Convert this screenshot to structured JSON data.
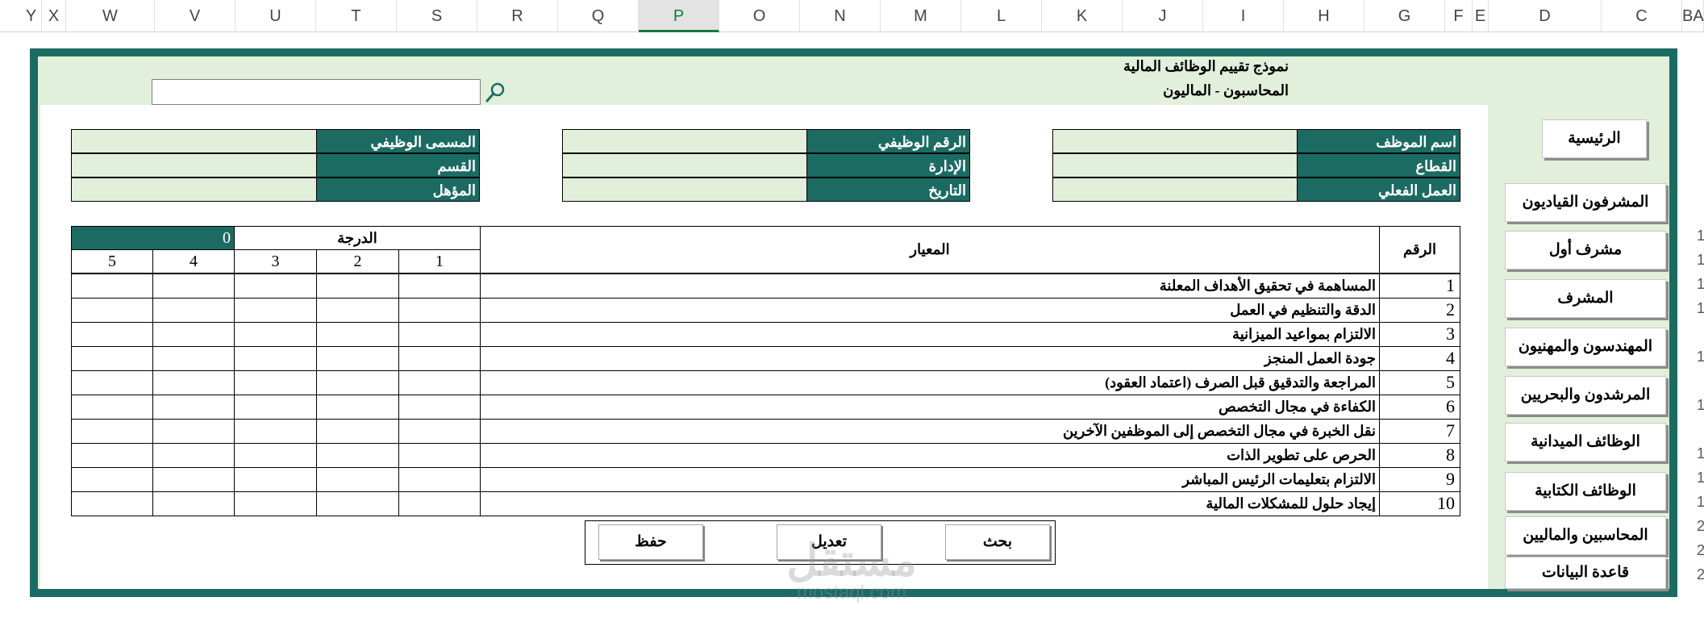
{
  "columns": [
    "Y",
    "X",
    "W",
    "V",
    "U",
    "T",
    "S",
    "R",
    "Q",
    "P",
    "O",
    "N",
    "M",
    "L",
    "K",
    "J",
    "I",
    "H",
    "G",
    "F",
    "E",
    "D",
    "C",
    "BA"
  ],
  "active_column": "P",
  "row_numbers": [
    "1",
    "1",
    "1",
    "1",
    "1",
    "1",
    "1",
    "1",
    "1",
    "2",
    "2",
    "2"
  ],
  "header": {
    "title": "نموذج تقييم الوظائف المالية",
    "subtitle": "المحاسبون  -  الماليون"
  },
  "search": {
    "value": "",
    "icon": "search-icon"
  },
  "info": {
    "employee_name_label": "اسم الموظف",
    "sector_label": "القطاع",
    "actual_work_label": "العمل الفعلي",
    "job_number_label": "الرقم الوظيفي",
    "department_label": "الإدارة",
    "date_label": "التاريخ",
    "job_title_label": "المسمى الوظيفي",
    "section_label": "القسم",
    "qualification_label": "المؤهل"
  },
  "grid": {
    "number_header": "الرقم",
    "criterion_header": "المعيار",
    "grade_header": "الدرجة",
    "total": "0",
    "score_columns": [
      "1",
      "2",
      "3",
      "4",
      "5"
    ],
    "rows": [
      {
        "num": "1",
        "criterion": "المساهمة في تحقيق الأهداف المعلنة"
      },
      {
        "num": "2",
        "criterion": "الدقة والتنظيم في العمل"
      },
      {
        "num": "3",
        "criterion": "الالتزام بمواعيد الميزانية"
      },
      {
        "num": "4",
        "criterion": "جودة العمل المنجز"
      },
      {
        "num": "5",
        "criterion": "المراجعة والتدقيق قبل الصرف (اعتماد العقود)"
      },
      {
        "num": "6",
        "criterion": "الكفاءة في مجال التخصص"
      },
      {
        "num": "7",
        "criterion": "نقل الخبرة في مجال التخصص إلى الموظفين الآخرين"
      },
      {
        "num": "8",
        "criterion": "الحرص على تطوير الذات"
      },
      {
        "num": "9",
        "criterion": "الالتزام بتعليمات الرئيس المباشر"
      },
      {
        "num": "10",
        "criterion": "إيجاد حلول للمشكلات المالية"
      }
    ]
  },
  "actions": {
    "search": "بحث",
    "edit": "تعديل",
    "save": "حفظ"
  },
  "nav": [
    "الرئيسية",
    "المشرفون القياديون",
    "مشرف أول",
    "المشرف",
    "المهندسون والمهنيون",
    "المرشدون والبحريين",
    "الوظائف الميدانية",
    "الوظائف الكتابية",
    "المحاسبين والماليين",
    "قاعدة البيانات"
  ],
  "watermark": {
    "arabic": "مستقل",
    "latin": "mostaql.com"
  },
  "colors": {
    "teal": "#1b6b63",
    "light_green": "#e2efda",
    "excel_green": "#107c41"
  }
}
